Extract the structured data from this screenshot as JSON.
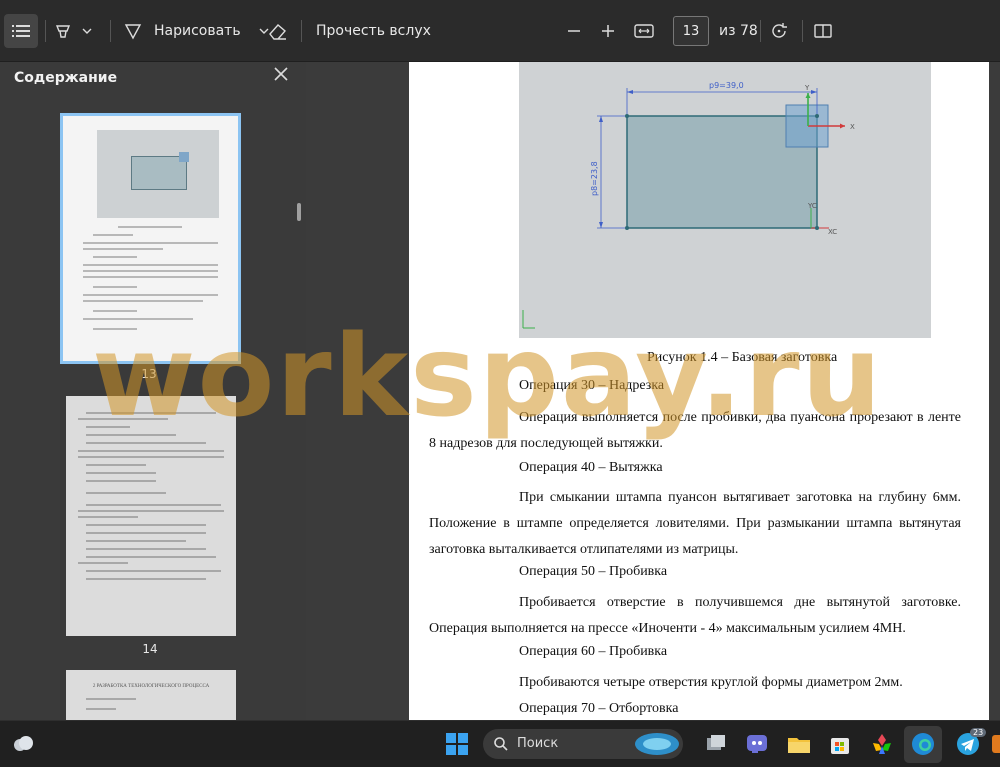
{
  "toolbar": {
    "draw_label": "Нарисовать",
    "read_aloud_label": "Прочесть вслух",
    "page_input": "13",
    "page_total": "из 78",
    "icons": [
      "toc-icon",
      "highlight-icon",
      "chevron-down-icon",
      "draw-icon",
      "eraser-icon",
      "minus-icon",
      "plus-icon",
      "fit-page-icon",
      "rotate-icon",
      "two-page-icon"
    ]
  },
  "sidebar": {
    "title": "Содержание",
    "thumbnails": [
      {
        "page": "13",
        "selected": true
      },
      {
        "page": "14",
        "selected": false
      },
      {
        "page": "",
        "selected": false
      }
    ],
    "thumb15_heading": "2 РАЗРАБОТКА ТЕХНОЛОГИЧЕСКОГО ПРОЦЕССА"
  },
  "document": {
    "figure": {
      "dim_horizontal": "p9=39,0",
      "dim_vertical": "p8=23,8",
      "axis_x": "X",
      "axis_y": "Y",
      "axis_xc": "XC",
      "axis_yc": "YC"
    },
    "caption": "Рисунок 1.4 – Базовая заготовка",
    "op30_heading": "Операция 30 – Надрезка",
    "op30_text": "Операция выполняется после пробивки, два пуансона прорезают в ленте 8 надрезов для последующей вытяжки.",
    "op40_heading": "Операция 40 – Вытяжка",
    "op40_text": "При смыкании штампа пуансон вытягивает заготовка на глубину 6мм. Положение в штампе определяется ловителями. При размыкании штампа вытянутая заготовка выталкивается отлипателями из матрицы.",
    "op50_heading": "Операция 50 – Пробивка",
    "op50_text": "Пробивается отверстие в получившемся дне вытянутой заготовке. Операция выполняется на прессе «Иноченти - 4» максимальным усилием 4МН.",
    "op60_heading": "Операция 60 – Пробивка",
    "op60_text": "Пробиваются четыре отверстия круглой формы диаметром 2мм.",
    "op70_heading": "Операция 70 – Отбортовка"
  },
  "watermark": "workspay.ru",
  "taskbar": {
    "search_label": "Поиск",
    "telegram_badge": "23",
    "icons": [
      "weather-icon",
      "start-icon",
      "search-icon",
      "widgets-icon",
      "task-view-icon",
      "teams-icon",
      "explorer-icon",
      "store-icon",
      "photos-icon",
      "edge-icon",
      "telegram-icon",
      "app-icon"
    ]
  },
  "colors": {
    "accent": "#8cc4f2",
    "workpiece": "#9fb6bd",
    "dimension": "#3f5fc8",
    "watermark": "#d2962899"
  }
}
